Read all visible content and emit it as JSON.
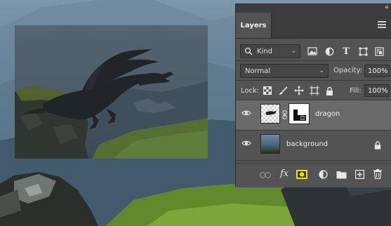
{
  "panel": {
    "collapse_glyph": "‹‹",
    "tab_label": "Layers",
    "filter": {
      "label": "Kind"
    },
    "blend_mode": "Normal",
    "opacity_label": "Opacity:",
    "opacity_value": "100%",
    "lock_label": "Lock:",
    "fill_label": "Fill:",
    "fill_value": "100%",
    "filter_icons": [
      "image-filter-icon",
      "adjustment-filter-icon",
      "type-filter-icon",
      "shape-filter-icon",
      "smart-object-filter-icon",
      "filter-toggle-icon"
    ],
    "lock_icons": [
      "lock-transparent-pixels-icon",
      "lock-image-pixels-icon",
      "lock-position-icon",
      "lock-artboard-icon",
      "lock-all-icon"
    ]
  },
  "layers": [
    {
      "name": "dragon",
      "selected": true,
      "visible": true,
      "has_mask": true,
      "locked": false
    },
    {
      "name": "background",
      "selected": false,
      "visible": true,
      "has_mask": false,
      "locked": true
    }
  ],
  "footer_icons": [
    "link-layers-icon",
    "fx-icon",
    "layer-mask-icon",
    "adjustment-layer-icon",
    "group-folder-icon",
    "new-layer-icon",
    "trash-icon"
  ],
  "colors": {
    "panel_bg": "#535353",
    "tab_bar_bg": "#3c3c3c",
    "selected_layer": "#696969",
    "mask_button_highlight": "#e6e600"
  }
}
